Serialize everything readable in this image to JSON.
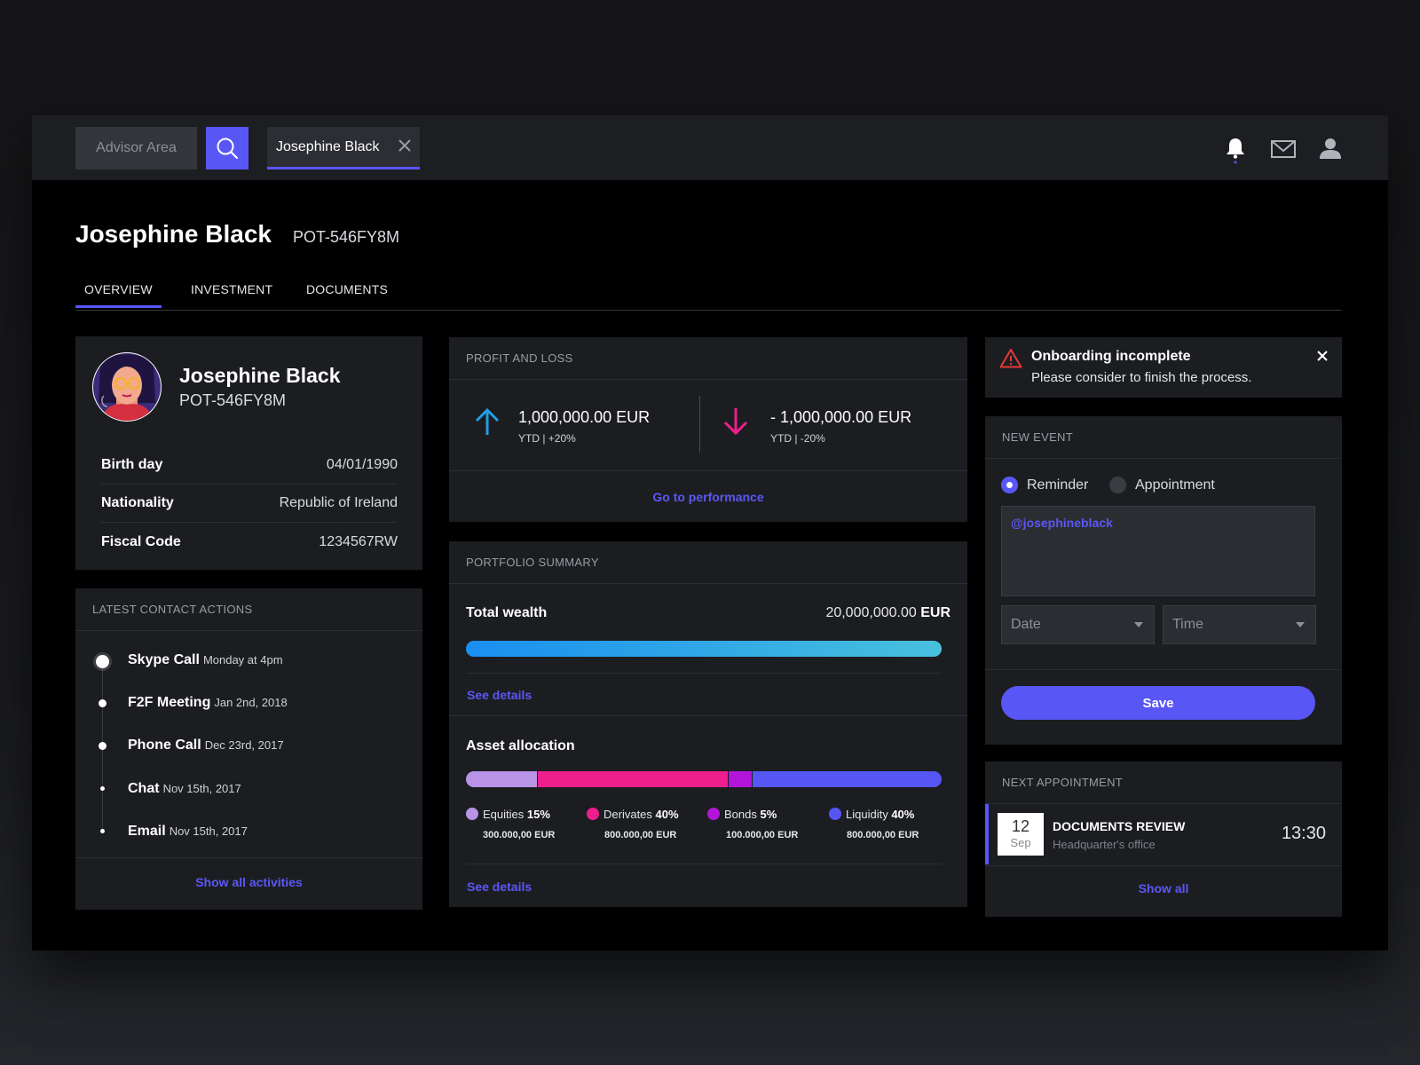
{
  "topbar": {
    "advisor_label": "Advisor Area",
    "client_tab_label": "Josephine Black"
  },
  "header": {
    "name": "Josephine Black",
    "code": "POT-546FY8M",
    "tabs": [
      {
        "label": "OVERVIEW",
        "active": true
      },
      {
        "label": "INVESTMENT",
        "active": false
      },
      {
        "label": "DOCUMENTS",
        "active": false
      }
    ]
  },
  "profile": {
    "name": "Josephine Black",
    "code": "POT-546FY8M",
    "fields": [
      {
        "key": "Birth day",
        "value": "04/01/1990"
      },
      {
        "key": "Nationality",
        "value": "Republic of Ireland"
      },
      {
        "key": "Fiscal Code",
        "value": "1234567RW"
      }
    ]
  },
  "contacts": {
    "title": "LATEST CONTACT ACTIONS",
    "items": [
      {
        "type": "Skype Call",
        "date": "Monday at 4pm"
      },
      {
        "type": "F2F Meeting",
        "date": "Jan 2nd, 2018"
      },
      {
        "type": "Phone Call",
        "date": "Dec 23rd, 2017"
      },
      {
        "type": "Chat",
        "date": "Nov 15th, 2017"
      },
      {
        "type": "Email",
        "date": "Nov 15th, 2017"
      }
    ],
    "show_all": "Show all activities"
  },
  "pnl": {
    "title": "PROFIT AND  LOSS",
    "gain": {
      "value": "1,000,000.00 EUR",
      "sub": "YTD | +20%"
    },
    "loss": {
      "value": "- 1,000,000.00 EUR",
      "sub": "YTD | -20%"
    },
    "link": "Go to performance"
  },
  "portfolio": {
    "title": "PORTFOLIO SUMMARY",
    "total_label": "Total wealth",
    "total_value": "20,000,000.00",
    "total_currency": "EUR",
    "see_details_1": "See details",
    "allocation_label": "Asset allocation",
    "allocation": [
      {
        "name": "Equities",
        "pct": "15%",
        "share": 0.15,
        "amount": "300.000,00 EUR",
        "color": "#b893e6"
      },
      {
        "name": "Derivates",
        "pct": "40%",
        "share": 0.4,
        "amount": "800.000,00 EUR",
        "color": "#ee1e8c"
      },
      {
        "name": "Bonds",
        "pct": "5%",
        "share": 0.05,
        "amount": "100.000,00 EUR",
        "color": "#b315d8"
      },
      {
        "name": "Liquidity",
        "pct": "40%",
        "share": 0.4,
        "amount": "800.000,00 EUR",
        "color": "#5556f4"
      }
    ],
    "see_details_2": "See details"
  },
  "alert": {
    "title": "Onboarding incomplete",
    "message": "Please consider to finish the  process."
  },
  "new_event": {
    "title": "NEW EVENT",
    "option_reminder": "Reminder",
    "option_appointment": "Appointment",
    "text_value": "@josephineblack",
    "date_placeholder": "Date",
    "time_placeholder": "Time",
    "save_label": "Save"
  },
  "next_appointment": {
    "title": "NEXT APPOINTMENT",
    "day": "12",
    "month": "Sep",
    "name": "DOCUMENTS REVIEW",
    "location": "Headquarter's office",
    "time": "13:30",
    "show_all": "Show all"
  },
  "colors": {
    "accent": "#5856f5",
    "gain": "#1ea0e6",
    "loss": "#ee1e8c",
    "alert": "#e53935"
  }
}
